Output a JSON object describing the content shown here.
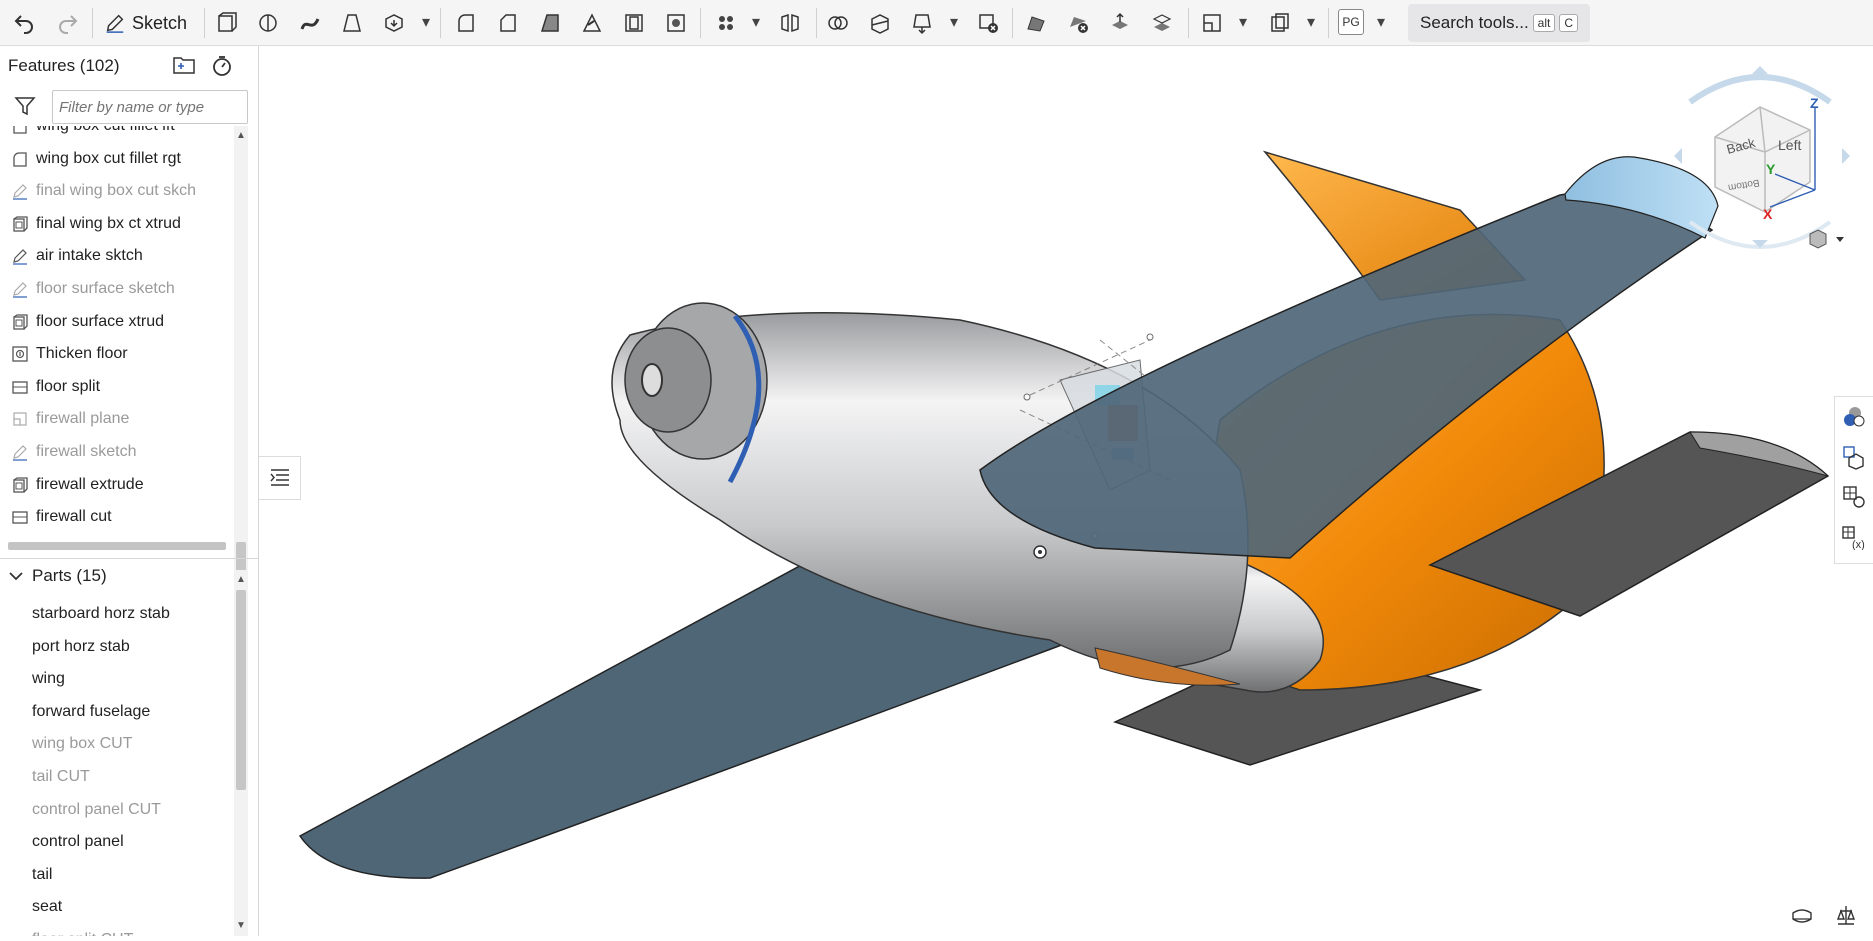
{
  "toolbar": {
    "sketch_label": "Sketch",
    "search_label": "Search tools...",
    "search_kbd_1": "alt",
    "search_kbd_2": "C",
    "pg_label": "PG"
  },
  "features": {
    "header": "Features (102)",
    "filter_placeholder": "Filter by name or type",
    "items": [
      {
        "label": "wing box cut fillet lft",
        "type": "fillet",
        "dim": false
      },
      {
        "label": "wing box cut fillet rgt",
        "type": "fillet",
        "dim": false
      },
      {
        "label": "final wing box cut skch",
        "type": "sketch",
        "dim": true
      },
      {
        "label": "final wing bx ct xtrud",
        "type": "extrude",
        "dim": false
      },
      {
        "label": "air intake sktch",
        "type": "sketch",
        "dim": false
      },
      {
        "label": "floor surface sketch",
        "type": "sketch",
        "dim": true
      },
      {
        "label": "floor surface xtrud",
        "type": "extrude",
        "dim": false
      },
      {
        "label": "Thicken floor",
        "type": "thicken",
        "dim": false
      },
      {
        "label": "floor split",
        "type": "split",
        "dim": false
      },
      {
        "label": "firewall plane",
        "type": "plane",
        "dim": true
      },
      {
        "label": "firewall sketch",
        "type": "sketch",
        "dim": true
      },
      {
        "label": "firewall extrude",
        "type": "extrude",
        "dim": false
      },
      {
        "label": "firewall cut",
        "type": "split",
        "dim": false
      }
    ]
  },
  "parts": {
    "header": "Parts (15)",
    "items": [
      {
        "label": "starboard horz stab",
        "dim": false
      },
      {
        "label": "port horz stab",
        "dim": false
      },
      {
        "label": "wing",
        "dim": false
      },
      {
        "label": "forward fuselage",
        "dim": false
      },
      {
        "label": "wing box CUT",
        "dim": true
      },
      {
        "label": "tail CUT",
        "dim": true
      },
      {
        "label": "control panel CUT",
        "dim": true
      },
      {
        "label": "control panel",
        "dim": false
      },
      {
        "label": "tail",
        "dim": false
      },
      {
        "label": "seat",
        "dim": false
      },
      {
        "label": "floor split CUT",
        "dim": true
      }
    ]
  },
  "viewcube": {
    "face_top": "Back",
    "face_front": "Left",
    "face_side": "Bottom",
    "axis_x": "X",
    "axis_y": "Y",
    "axis_z": "Z"
  },
  "colors": {
    "wing": "#4f6677",
    "tail": "#f28a0a",
    "fuselage": "#d9dadc",
    "stab": "#555555",
    "accent": "#2f5fb3"
  }
}
